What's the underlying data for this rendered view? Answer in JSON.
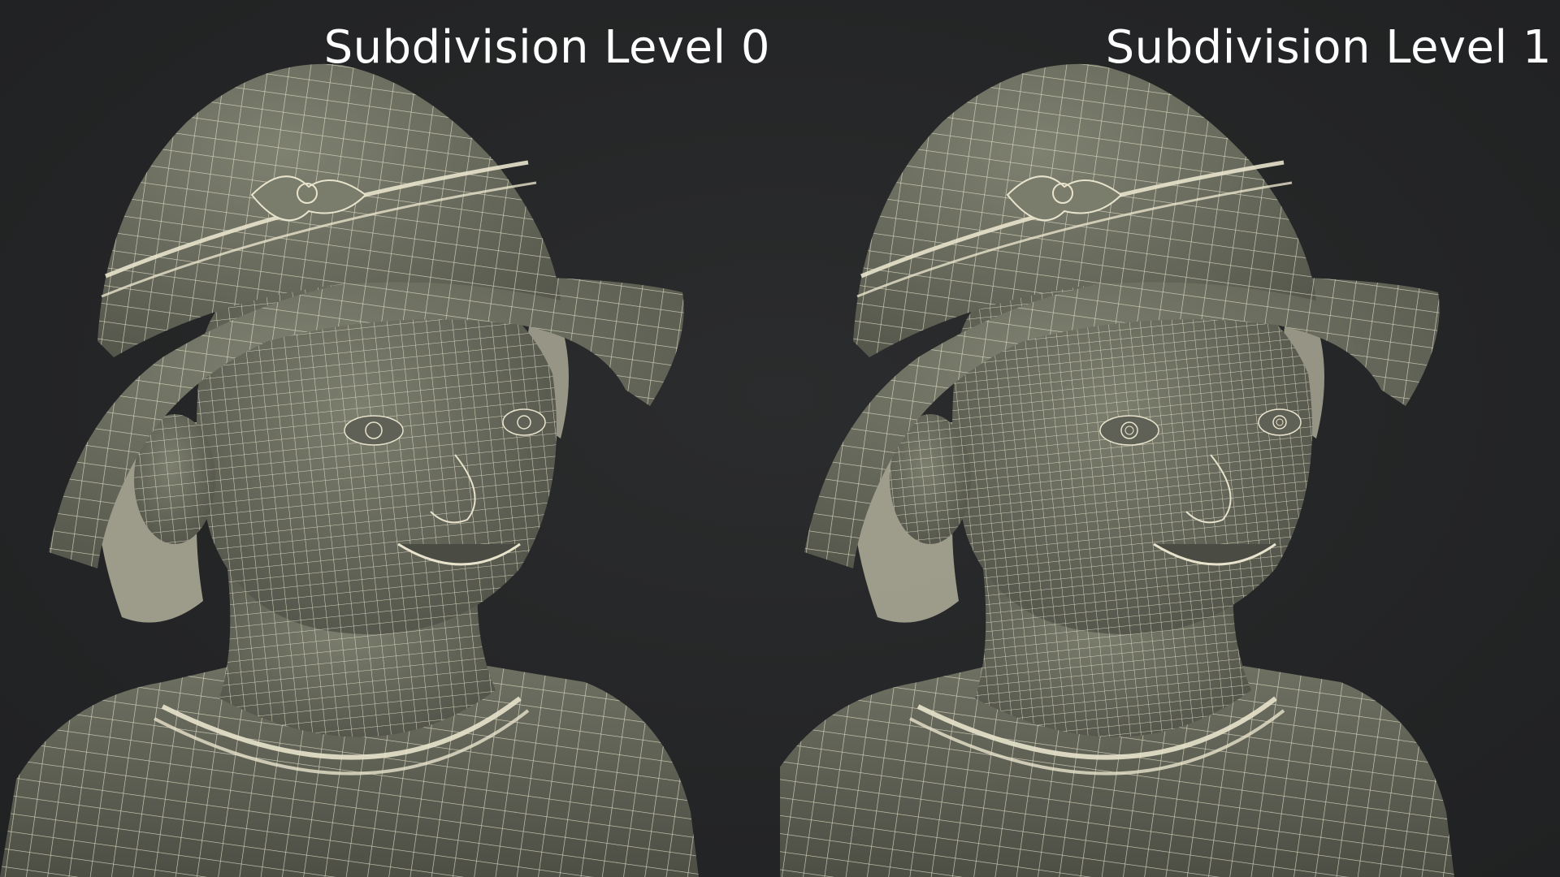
{
  "scene": {
    "background_color": "#262728",
    "mesh_fill_color": "#6e7062",
    "wire_color": "#e8e3cc",
    "hair_color": "#b9b6a2"
  },
  "panels": [
    {
      "label": "Subdivision Level 0",
      "subdivision": 0
    },
    {
      "label": "Subdivision Level 1",
      "subdivision": 1
    }
  ]
}
